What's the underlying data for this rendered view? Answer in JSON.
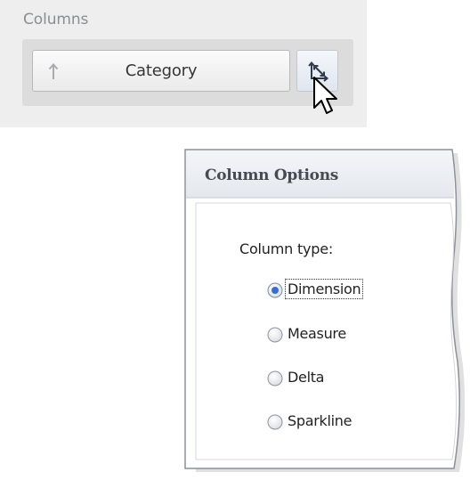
{
  "columns_panel": {
    "title": "Columns",
    "item": {
      "label": "Category",
      "sort_icon": "sort-arrow-up-icon"
    },
    "options_button_icon": "axes-swap-icon"
  },
  "column_options": {
    "title": "Column Options",
    "type_label": "Column type:",
    "options": [
      {
        "label": "Dimension",
        "selected": true
      },
      {
        "label": "Measure",
        "selected": false
      },
      {
        "label": "Delta",
        "selected": false
      },
      {
        "label": "Sparkline",
        "selected": false
      }
    ]
  },
  "colors": {
    "panel_bg": "#eeeeef",
    "accent_radio": "#3a6cc8",
    "title_text": "#474a50"
  }
}
